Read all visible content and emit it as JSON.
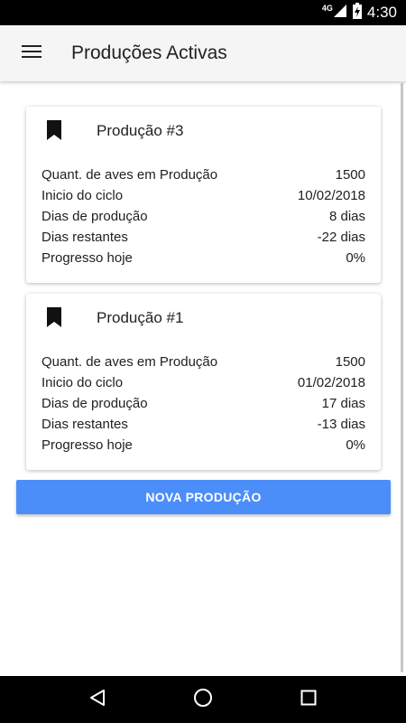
{
  "status_bar": {
    "network": "4G",
    "time": "4:30"
  },
  "app_bar": {
    "title": "Produções Activas",
    "menu_icon": "hamburger-menu-icon"
  },
  "productions": [
    {
      "title": "Produção #3",
      "icon": "bookmark-icon",
      "rows": [
        {
          "label": "Quant. de aves em Produção",
          "value": "1500"
        },
        {
          "label": "Inicio do ciclo",
          "value": "10/02/2018"
        },
        {
          "label": "Dias de produção",
          "value": "8 dias"
        },
        {
          "label": "Dias restantes",
          "value": "-22 dias"
        },
        {
          "label": "Progresso hoje",
          "value": "0%"
        }
      ]
    },
    {
      "title": "Produção #1",
      "icon": "bookmark-icon",
      "rows": [
        {
          "label": "Quant. de aves em Produção",
          "value": "1500"
        },
        {
          "label": "Inicio do ciclo",
          "value": "01/02/2018"
        },
        {
          "label": "Dias de produção",
          "value": "17 dias"
        },
        {
          "label": "Dias restantes",
          "value": "-13 dias"
        },
        {
          "label": "Progresso hoje",
          "value": "0%"
        }
      ]
    }
  ],
  "new_production_button": "NOVA PRODUÇÃO",
  "colors": {
    "primary_button": "#4b8ef9",
    "app_bar": "#f5f5f5",
    "system_bars": "#000000"
  },
  "nav_bar": {
    "back_icon": "back-triangle-icon",
    "home_icon": "home-circle-icon",
    "recents_icon": "recents-square-icon"
  }
}
